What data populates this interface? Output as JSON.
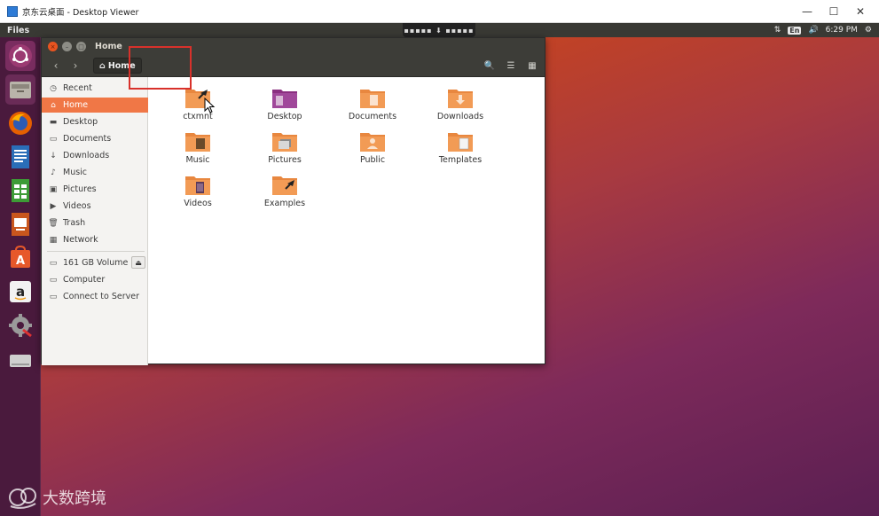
{
  "host_window": {
    "title": "京东云桌面 - Desktop Viewer",
    "minimize": "—",
    "maximize": "☐",
    "close": "✕"
  },
  "top_panel": {
    "app_name": "Files",
    "handle_glyphs": "▪▪▪▪▪ ⬇ ▪▪▪▪▪",
    "network_glyph": "⇅",
    "language": "En",
    "volume_glyph": "🔊",
    "time": "6:29 PM",
    "settings_glyph": "⚙"
  },
  "launcher": {
    "items": [
      "ubuntu-dash",
      "files",
      "firefox",
      "libreoffice-writer",
      "libreoffice-calc",
      "libreoffice-impress",
      "ubuntu-software",
      "amazon",
      "system-settings",
      "disk"
    ]
  },
  "window": {
    "title": "Home",
    "close_glyph": "×",
    "min_glyph": "–",
    "max_glyph": "□",
    "back_glyph": "‹",
    "forward_glyph": "›",
    "home_glyph": "⌂",
    "path_label": "Home",
    "search_glyph": "🔍",
    "list_view_glyph": "☰",
    "grid_view_glyph": "▦"
  },
  "sidebar": {
    "places": [
      {
        "label": "Recent",
        "glyph": "◷"
      },
      {
        "label": "Home",
        "glyph": "⌂"
      },
      {
        "label": "Desktop",
        "glyph": "▬"
      },
      {
        "label": "Documents",
        "glyph": "▭"
      },
      {
        "label": "Downloads",
        "glyph": "↓"
      },
      {
        "label": "Music",
        "glyph": "♪"
      },
      {
        "label": "Pictures",
        "glyph": "▣"
      },
      {
        "label": "Videos",
        "glyph": "▶"
      },
      {
        "label": "Trash",
        "glyph": "🗑"
      },
      {
        "label": "Network",
        "glyph": "▦"
      }
    ],
    "devices": [
      {
        "label": "161 GB Volume",
        "glyph": "▭"
      },
      {
        "label": "Computer",
        "glyph": "▭"
      },
      {
        "label": "Connect to Server",
        "glyph": "▭"
      }
    ],
    "eject_glyph": "⏏"
  },
  "files": [
    {
      "label": "ctxmnt",
      "kind": "link"
    },
    {
      "label": "Desktop",
      "kind": "desktop"
    },
    {
      "label": "Documents",
      "kind": "documents"
    },
    {
      "label": "Downloads",
      "kind": "downloads"
    },
    {
      "label": "Music",
      "kind": "music"
    },
    {
      "label": "Pictures",
      "kind": "pictures"
    },
    {
      "label": "Public",
      "kind": "public"
    },
    {
      "label": "Templates",
      "kind": "templates"
    },
    {
      "label": "Videos",
      "kind": "videos"
    },
    {
      "label": "Examples",
      "kind": "link"
    }
  ],
  "watermark": {
    "text": "大数跨境"
  },
  "colors": {
    "accent": "#f07746",
    "highlight_border": "#d8312b",
    "folder": "#e8873f"
  }
}
